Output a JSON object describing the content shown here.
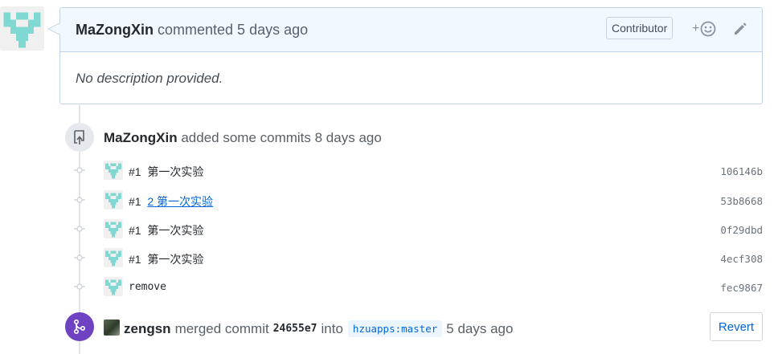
{
  "comment": {
    "author": "MaZongXin",
    "action_text": "commented 5 days ago",
    "badge": "Contributor",
    "reaction_plus": "+",
    "body": "No description provided."
  },
  "commits_event": {
    "author": "MaZongXin",
    "action_text": "added some commits 8 days ago",
    "icon": "repo-push-icon"
  },
  "commits": [
    {
      "prefix": "#1",
      "message": "第一次实验",
      "sha": "106146b",
      "link": false
    },
    {
      "prefix": "#1",
      "message": "2 第一次实验",
      "sha": "53b8668",
      "link": true
    },
    {
      "prefix": "#1",
      "message": "第一次实验",
      "sha": "0f29dbd",
      "link": false
    },
    {
      "prefix": "#1",
      "message": "第一次实验",
      "sha": "4ecf308",
      "link": false
    },
    {
      "prefix": "",
      "message": "remove",
      "sha": "fec9867",
      "link": false
    }
  ],
  "merge_event": {
    "author": "zengsn",
    "action_text": "merged commit",
    "commit_sha": "24655e7",
    "into_text": "into",
    "branch": "hzuapps:master",
    "time_text": "5 days ago",
    "revert_label": "Revert",
    "icon": "git-merge-icon"
  },
  "colors": {
    "accent_blue": "#0366d6",
    "merge_purple": "#6f42c1",
    "comment_header_bg": "#f1f8ff",
    "avatar_teal": "#7fd8d2"
  }
}
